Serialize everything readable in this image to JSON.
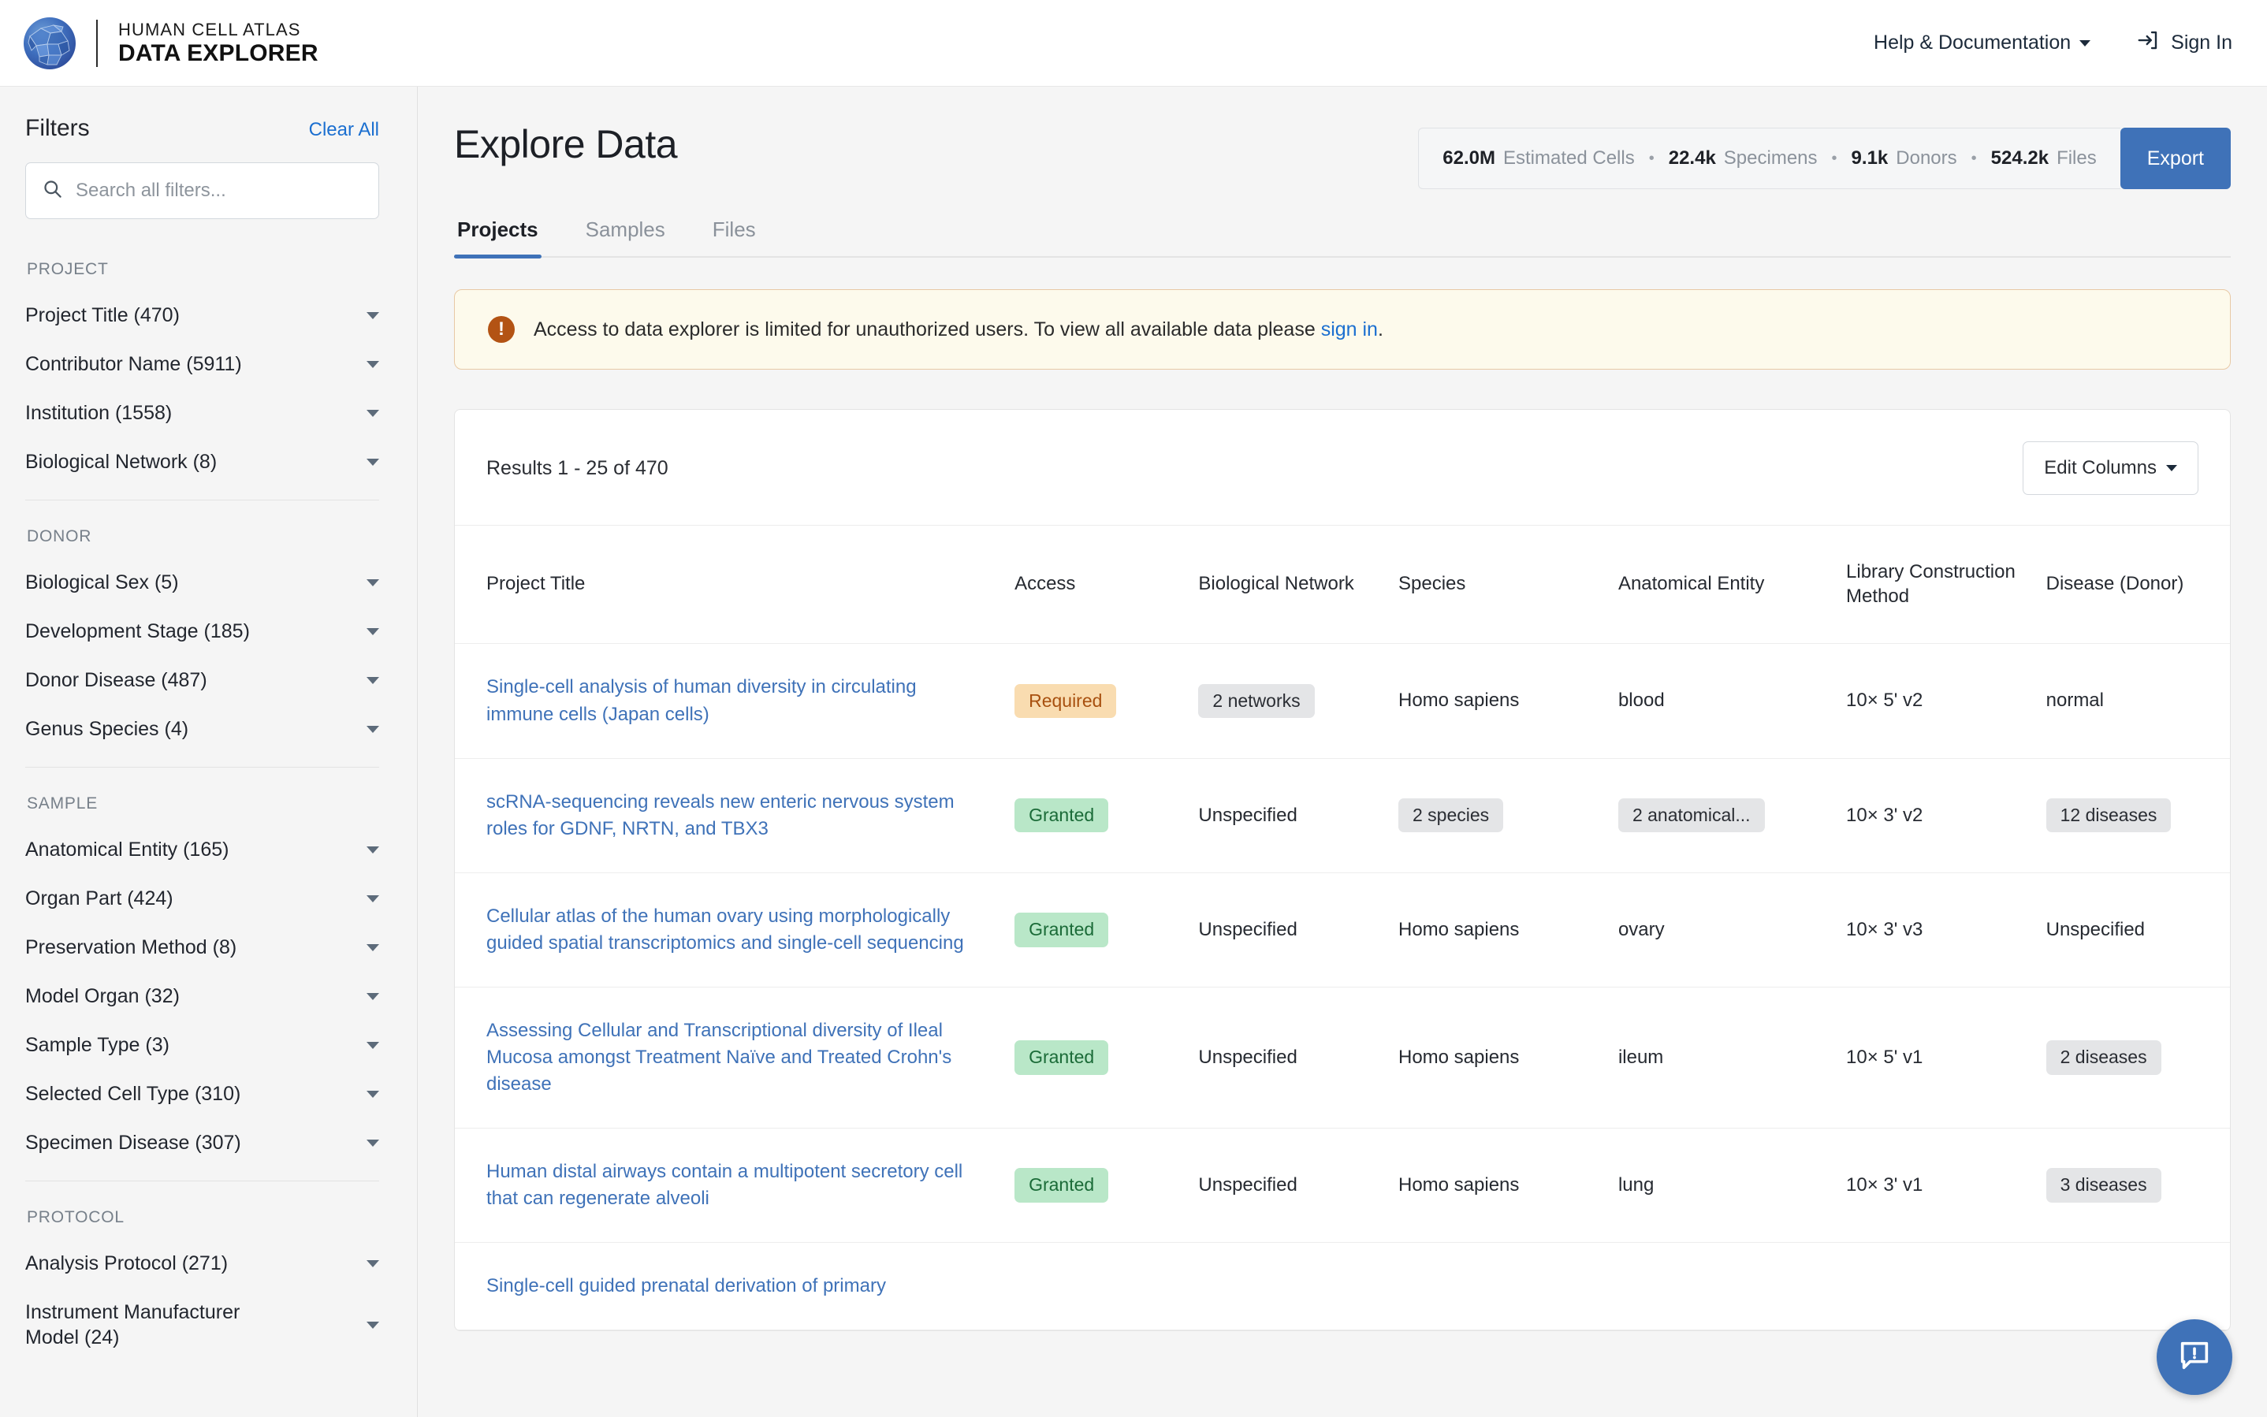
{
  "header": {
    "logo_icon": "cell-sphere-logo",
    "brand_top": "HUMAN CELL ATLAS",
    "brand_bottom": "DATA EXPLORER",
    "help_label": "Help & Documentation",
    "help_caret_icon": "chevron-down-icon",
    "signin_icon": "sign-in-icon",
    "signin_label": "Sign In"
  },
  "sidebar": {
    "title": "Filters",
    "clear_all": "Clear All",
    "search_icon": "search-icon",
    "search_placeholder": "Search all filters...",
    "search_value": "",
    "groups": [
      {
        "label": "PROJECT",
        "items": [
          {
            "label": "Project Title (470)"
          },
          {
            "label": "Contributor Name (5911)"
          },
          {
            "label": "Institution (1558)"
          },
          {
            "label": "Biological Network (8)"
          }
        ]
      },
      {
        "label": "DONOR",
        "items": [
          {
            "label": "Biological Sex (5)"
          },
          {
            "label": "Development Stage (185)"
          },
          {
            "label": "Donor Disease (487)"
          },
          {
            "label": "Genus Species (4)"
          }
        ]
      },
      {
        "label": "SAMPLE",
        "items": [
          {
            "label": "Anatomical Entity (165)"
          },
          {
            "label": "Organ Part (424)"
          },
          {
            "label": "Preservation Method (8)"
          },
          {
            "label": "Model Organ (32)"
          },
          {
            "label": "Sample Type (3)"
          },
          {
            "label": "Selected Cell Type (310)"
          },
          {
            "label": "Specimen Disease (307)"
          }
        ]
      },
      {
        "label": "PROTOCOL",
        "items": [
          {
            "label": "Analysis Protocol (271)"
          },
          {
            "label": "Instrument Manufacturer Model (24)"
          }
        ]
      }
    ]
  },
  "main": {
    "page_title": "Explore Data",
    "summary": [
      {
        "value": "62.0M",
        "label": "Estimated Cells"
      },
      {
        "value": "22.4k",
        "label": "Specimens"
      },
      {
        "value": "9.1k",
        "label": "Donors"
      },
      {
        "value": "524.2k",
        "label": "Files"
      }
    ],
    "summary_separator": "•",
    "export_label": "Export",
    "tabs": [
      {
        "label": "Projects",
        "active": true
      },
      {
        "label": "Samples",
        "active": false
      },
      {
        "label": "Files",
        "active": false
      }
    ],
    "alert": {
      "icon": "alert-exclamation-icon",
      "text_before": "Access to data explorer is limited for unauthorized users. To view all available data please ",
      "link_text": "sign in",
      "text_after": "."
    },
    "results_count": "Results 1 - 25 of 470",
    "edit_columns_label": "Edit Columns",
    "edit_columns_caret_icon": "chevron-down-icon",
    "table": {
      "columns": [
        "Project Title",
        "Access",
        "Biological Network",
        "Species",
        "Anatomical Entity",
        "Library Construction Method",
        "Disease (Donor)"
      ],
      "rows": [
        {
          "title": "Single-cell analysis of human diversity in circulating immune cells (Japan cells)",
          "access": {
            "text": "Required",
            "style": "chip-required"
          },
          "network": {
            "text": "2 networks",
            "style": "chip-grey"
          },
          "species": {
            "text": "Homo sapiens",
            "style": "plain"
          },
          "anatomical": {
            "text": "blood",
            "style": "plain"
          },
          "library": {
            "text": "10× 5' v2",
            "style": "plain"
          },
          "disease": {
            "text": "normal",
            "style": "plain"
          }
        },
        {
          "title": "scRNA-sequencing reveals new enteric nervous system roles for GDNF, NRTN, and TBX3",
          "access": {
            "text": "Granted",
            "style": "chip-granted"
          },
          "network": {
            "text": "Unspecified",
            "style": "plain"
          },
          "species": {
            "text": "2 species",
            "style": "chip-grey"
          },
          "anatomical": {
            "text": "2 anatomical...",
            "style": "chip-grey"
          },
          "library": {
            "text": "10× 3' v2",
            "style": "plain"
          },
          "disease": {
            "text": "12 diseases",
            "style": "chip-grey"
          }
        },
        {
          "title": "Cellular atlas of the human ovary using morphologically guided spatial transcriptomics and single-cell sequencing",
          "access": {
            "text": "Granted",
            "style": "chip-granted"
          },
          "network": {
            "text": "Unspecified",
            "style": "plain"
          },
          "species": {
            "text": "Homo sapiens",
            "style": "plain"
          },
          "anatomical": {
            "text": "ovary",
            "style": "plain"
          },
          "library": {
            "text": "10× 3' v3",
            "style": "plain"
          },
          "disease": {
            "text": "Unspecified",
            "style": "plain"
          }
        },
        {
          "title": "Assessing Cellular and Transcriptional diversity of Ileal Mucosa amongst Treatment Naïve and Treated Crohn's disease",
          "access": {
            "text": "Granted",
            "style": "chip-granted"
          },
          "network": {
            "text": "Unspecified",
            "style": "plain"
          },
          "species": {
            "text": "Homo sapiens",
            "style": "plain"
          },
          "anatomical": {
            "text": "ileum",
            "style": "plain"
          },
          "library": {
            "text": "10× 5' v1",
            "style": "plain"
          },
          "disease": {
            "text": "2 diseases",
            "style": "chip-grey"
          }
        },
        {
          "title": "Human distal airways contain a multipotent secretory cell that can regenerate alveoli",
          "access": {
            "text": "Granted",
            "style": "chip-granted"
          },
          "network": {
            "text": "Unspecified",
            "style": "plain"
          },
          "species": {
            "text": "Homo sapiens",
            "style": "plain"
          },
          "anatomical": {
            "text": "lung",
            "style": "plain"
          },
          "library": {
            "text": "10× 3' v1",
            "style": "plain"
          },
          "disease": {
            "text": "3 diseases",
            "style": "chip-grey"
          }
        },
        {
          "title": "Single-cell guided prenatal derivation of primary",
          "access": {
            "text": "",
            "style": "plain"
          },
          "network": {
            "text": "",
            "style": "plain"
          },
          "species": {
            "text": "",
            "style": "plain"
          },
          "anatomical": {
            "text": "",
            "style": "plain"
          },
          "library": {
            "text": "",
            "style": "plain"
          },
          "disease": {
            "text": "",
            "style": "plain"
          }
        }
      ]
    },
    "feedback_icon": "feedback-chat-icon"
  },
  "colors": {
    "accent": "#3f72b8",
    "link": "#1b6fd0",
    "alert_bg": "#fdfaec",
    "alert_border": "#e8c9a5",
    "alert_icon": "#b35314",
    "chip_required_bg": "#f9dcb0",
    "chip_granted_bg": "#b9e7c8",
    "chip_grey_bg": "#e4e5e7"
  }
}
